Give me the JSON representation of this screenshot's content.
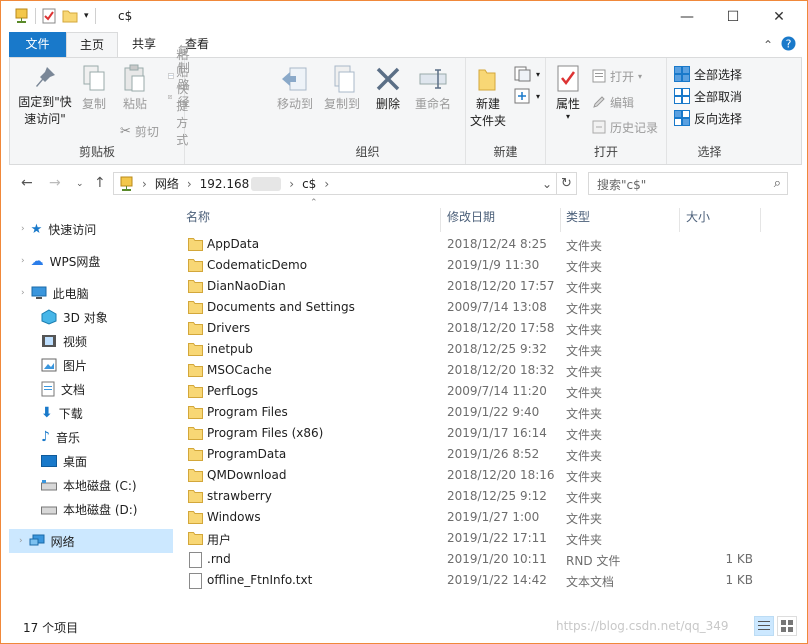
{
  "window": {
    "title": "c$"
  },
  "ribbon_tabs": {
    "file": "文件",
    "home": "主页",
    "share": "共享",
    "view": "查看"
  },
  "ribbon": {
    "clipboard": {
      "pin": "固定到\"快\n速访问\"",
      "copy": "复制",
      "paste": "粘贴",
      "copy_path": "复制路径",
      "paste_shortcut": "粘贴快捷方式",
      "cut": "剪切",
      "label": "剪贴板"
    },
    "organize": {
      "move_to": "移动到",
      "copy_to": "复制到",
      "delete": "删除",
      "rename": "重命名",
      "label": "组织"
    },
    "new": {
      "new_folder": "新建\n文件夹",
      "label": "新建"
    },
    "open": {
      "properties": "属性",
      "open": "打开",
      "edit": "编辑",
      "history": "历史记录",
      "label": "打开"
    },
    "select": {
      "select_all": "全部选择",
      "select_none": "全部取消",
      "invert": "反向选择",
      "label": "选择"
    }
  },
  "address": {
    "segments": [
      "网络",
      "192.168",
      "c$"
    ],
    "search_placeholder": "搜索\"c$\""
  },
  "nav": {
    "items": [
      {
        "label": "快速访问",
        "icon": "star-icon"
      },
      {
        "label": "WPS网盘",
        "icon": "cloud-icon"
      },
      {
        "label": "此电脑",
        "icon": "computer-icon"
      },
      {
        "label": "3D 对象",
        "icon": "cube-icon"
      },
      {
        "label": "视频",
        "icon": "video-icon"
      },
      {
        "label": "图片",
        "icon": "picture-icon"
      },
      {
        "label": "文档",
        "icon": "document-icon"
      },
      {
        "label": "下载",
        "icon": "download-icon"
      },
      {
        "label": "音乐",
        "icon": "music-icon"
      },
      {
        "label": "桌面",
        "icon": "desktop-icon"
      },
      {
        "label": "本地磁盘 (C:)",
        "icon": "drive-icon"
      },
      {
        "label": "本地磁盘 (D:)",
        "icon": "drive-icon"
      },
      {
        "label": "网络",
        "icon": "network-icon"
      }
    ]
  },
  "columns": {
    "name": "名称",
    "date": "修改日期",
    "type": "类型",
    "size": "大小"
  },
  "files": [
    {
      "name": "AppData",
      "date": "2018/12/24 8:25",
      "type": "文件夹",
      "size": "",
      "kind": "folder"
    },
    {
      "name": "CodematicDemo",
      "date": "2019/1/9 11:30",
      "type": "文件夹",
      "size": "",
      "kind": "folder"
    },
    {
      "name": "DianNaoDian",
      "date": "2018/12/20 17:57",
      "type": "文件夹",
      "size": "",
      "kind": "folder"
    },
    {
      "name": "Documents and Settings",
      "date": "2009/7/14 13:08",
      "type": "文件夹",
      "size": "",
      "kind": "folder"
    },
    {
      "name": "Drivers",
      "date": "2018/12/20 17:58",
      "type": "文件夹",
      "size": "",
      "kind": "folder"
    },
    {
      "name": "inetpub",
      "date": "2018/12/25 9:32",
      "type": "文件夹",
      "size": "",
      "kind": "folder"
    },
    {
      "name": "MSOCache",
      "date": "2018/12/20 18:32",
      "type": "文件夹",
      "size": "",
      "kind": "folder"
    },
    {
      "name": "PerfLogs",
      "date": "2009/7/14 11:20",
      "type": "文件夹",
      "size": "",
      "kind": "folder"
    },
    {
      "name": "Program Files",
      "date": "2019/1/22 9:40",
      "type": "文件夹",
      "size": "",
      "kind": "folder"
    },
    {
      "name": "Program Files (x86)",
      "date": "2019/1/17 16:14",
      "type": "文件夹",
      "size": "",
      "kind": "folder"
    },
    {
      "name": "ProgramData",
      "date": "2019/1/26 8:52",
      "type": "文件夹",
      "size": "",
      "kind": "folder"
    },
    {
      "name": "QMDownload",
      "date": "2018/12/20 18:16",
      "type": "文件夹",
      "size": "",
      "kind": "folder"
    },
    {
      "name": "strawberry",
      "date": "2018/12/25 9:12",
      "type": "文件夹",
      "size": "",
      "kind": "folder"
    },
    {
      "name": "Windows",
      "date": "2019/1/27 1:00",
      "type": "文件夹",
      "size": "",
      "kind": "folder"
    },
    {
      "name": "用户",
      "date": "2019/1/22 17:11",
      "type": "文件夹",
      "size": "",
      "kind": "folder"
    },
    {
      "name": ".rnd",
      "date": "2019/1/20 10:11",
      "type": "RND 文件",
      "size": "1 KB",
      "kind": "file"
    },
    {
      "name": "offline_FtnInfo.txt",
      "date": "2019/1/22 14:42",
      "type": "文本文档",
      "size": "1 KB",
      "kind": "file"
    }
  ],
  "status": {
    "count": "17 个项目",
    "watermark": "https://blog.csdn.net/qq_349"
  }
}
